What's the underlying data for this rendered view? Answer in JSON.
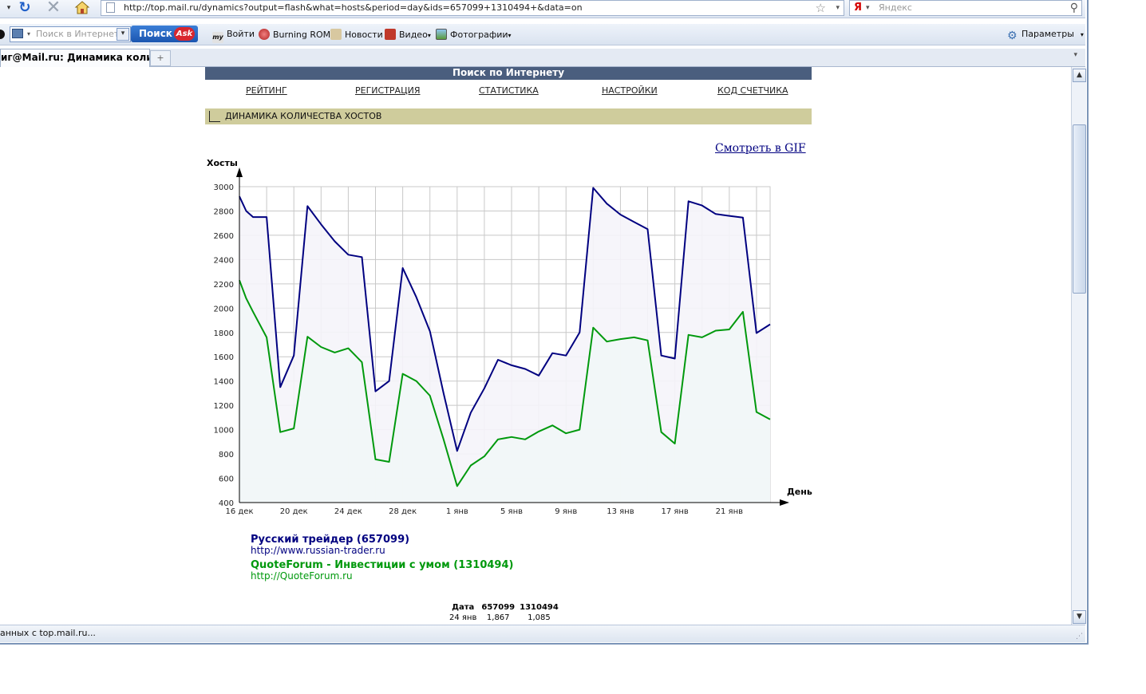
{
  "browser": {
    "url": "http://top.mail.ru/dynamics?output=flash&what=hosts&period=day&ids=657099+1310494+&data=on",
    "yandex_placeholder": "Яндекс",
    "ya_logo": "Я",
    "ask_placeholder": "Поиск в Интернете",
    "ask_button": "Поиск",
    "ask_logo": "Ask",
    "toolbar_items": [
      "Войти",
      "Burning ROM",
      "Новости",
      "Видео",
      "Фотографии"
    ],
    "params": "Параметры",
    "tab_title": "иг@Mail.ru: Динамика количе...",
    "status_text": "анных с top.mail.ru...",
    "icons": [
      "refresh-icon",
      "stop-icon",
      "home-icon",
      "star-icon",
      "search-icon",
      "gear-icon"
    ]
  },
  "page": {
    "banner": "Поиск по Интернету",
    "menu": [
      "РЕЙТИНГ",
      "РЕГИСТРАЦИЯ",
      "СТАТИСТИКА",
      "НАСТРОЙКИ",
      "КОД СЧЕТЧИКА"
    ],
    "section_title": "ДИНАМИКА КОЛИЧЕСТВА ХОСТОВ",
    "gif_link": "Смотреть в GIF",
    "legend": [
      {
        "title": "Русский трейдер (657099)",
        "url": "http://www.russian-trader.ru",
        "color": "#000080"
      },
      {
        "title": "QuoteForum - Инвестиции с умом (1310494)",
        "url": "http://QuoteForum.ru",
        "color": "#00990d"
      }
    ],
    "table": {
      "headers": [
        "Дата",
        "657099",
        "1310494"
      ],
      "rows": [
        [
          "24 янв",
          "1,867",
          "1,085"
        ]
      ]
    }
  },
  "chart_data": {
    "type": "line",
    "ylabel": "Хосты",
    "xlabel": "День",
    "ylim": [
      400,
      3000
    ],
    "yticks": [
      400,
      600,
      800,
      1000,
      1200,
      1400,
      1600,
      1800,
      2000,
      2200,
      2400,
      2600,
      2800,
      3000
    ],
    "x_tick_labels": [
      "16 дек",
      "20 дек",
      "24 дек",
      "28 дек",
      "1 янв",
      "5 янв",
      "9 янв",
      "13 янв",
      "17 янв",
      "21 янв"
    ],
    "x_tick_days": [
      0,
      4,
      8,
      12,
      16,
      20,
      24,
      28,
      32,
      36
    ],
    "x_range_days": [
      0,
      39
    ],
    "grid": true,
    "legend_position": "bottom",
    "series": [
      {
        "name": "Русский трейдер (657099)",
        "color": "#000080",
        "fill": "#f5f4f9",
        "points": [
          [
            0,
            2920
          ],
          [
            0.5,
            2800
          ],
          [
            1,
            2750
          ],
          [
            2,
            2750
          ],
          [
            3,
            1350
          ],
          [
            4,
            1610
          ],
          [
            5,
            2840
          ],
          [
            6,
            2690
          ],
          [
            7,
            2550
          ],
          [
            8,
            2440
          ],
          [
            9,
            2420
          ],
          [
            10,
            1315
          ],
          [
            11,
            1400
          ],
          [
            12,
            2330
          ],
          [
            13,
            2090
          ],
          [
            14,
            1810
          ],
          [
            15,
            1300
          ],
          [
            16,
            825
          ],
          [
            17,
            1140
          ],
          [
            18,
            1340
          ],
          [
            19,
            1575
          ],
          [
            20,
            1530
          ],
          [
            21,
            1500
          ],
          [
            22,
            1445
          ],
          [
            23,
            1630
          ],
          [
            24,
            1610
          ],
          [
            25,
            1800
          ],
          [
            26,
            2990
          ],
          [
            27,
            2860
          ],
          [
            28,
            2770
          ],
          [
            29,
            2710
          ],
          [
            30,
            2650
          ],
          [
            31,
            1610
          ],
          [
            32,
            1585
          ],
          [
            33,
            2880
          ],
          [
            34,
            2845
          ],
          [
            35,
            2775
          ],
          [
            36,
            2760
          ],
          [
            37,
            2745
          ],
          [
            38,
            1795
          ],
          [
            39,
            1867
          ]
        ]
      },
      {
        "name": "QuoteForum - Инвестиции с умом (1310494)",
        "color": "#00990d",
        "fill": "#f2f7f7",
        "points": [
          [
            0,
            2230
          ],
          [
            0.5,
            2080
          ],
          [
            1,
            1970
          ],
          [
            2,
            1760
          ],
          [
            3,
            980
          ],
          [
            4,
            1010
          ],
          [
            5,
            1765
          ],
          [
            6,
            1680
          ],
          [
            7,
            1635
          ],
          [
            8,
            1670
          ],
          [
            9,
            1555
          ],
          [
            10,
            755
          ],
          [
            11,
            735
          ],
          [
            12,
            1460
          ],
          [
            13,
            1400
          ],
          [
            14,
            1280
          ],
          [
            15,
            920
          ],
          [
            16,
            535
          ],
          [
            17,
            705
          ],
          [
            18,
            780
          ],
          [
            19,
            920
          ],
          [
            20,
            940
          ],
          [
            21,
            920
          ],
          [
            22,
            985
          ],
          [
            23,
            1035
          ],
          [
            24,
            970
          ],
          [
            25,
            1000
          ],
          [
            26,
            1840
          ],
          [
            27,
            1725
          ],
          [
            28,
            1745
          ],
          [
            29,
            1760
          ],
          [
            30,
            1735
          ],
          [
            31,
            980
          ],
          [
            32,
            885
          ],
          [
            33,
            1780
          ],
          [
            34,
            1760
          ],
          [
            35,
            1815
          ],
          [
            36,
            1825
          ],
          [
            37,
            1970
          ],
          [
            38,
            1145
          ],
          [
            39,
            1085
          ]
        ]
      }
    ]
  }
}
